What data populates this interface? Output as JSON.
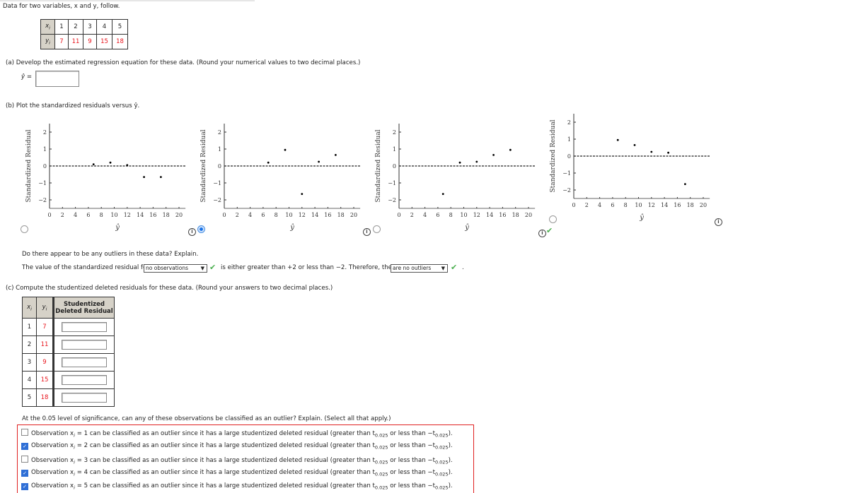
{
  "intro": "Data for two variables, x and y, follow.",
  "data_table": {
    "x_label": "x",
    "x_sub": "i",
    "y_label": "y",
    "y_sub": "i",
    "x": [
      1,
      2,
      3,
      4,
      5
    ],
    "y": [
      7,
      11,
      9,
      15,
      18
    ]
  },
  "part_a": {
    "text": "(a)  Develop the estimated regression equation for these data. (Round your numerical values to two decimal places.)",
    "yhat_label": "ŷ =",
    "yhat_value": ""
  },
  "part_b": {
    "text": "(b)  Plot the standardized residuals versus ŷ."
  },
  "chart_data": [
    {
      "type": "scatter",
      "x": [
        6.8,
        9.4,
        12.0,
        14.6,
        17.2
      ],
      "y": [
        0.1,
        0.2,
        0.05,
        -0.65,
        -0.65
      ],
      "xlabel": "ŷ",
      "ylabel": "Standardized Residual",
      "xlim": [
        0,
        21
      ],
      "ylim": [
        -2.5,
        2.5
      ],
      "xticks": [
        0,
        2,
        4,
        6,
        8,
        10,
        12,
        14,
        16,
        18,
        20
      ],
      "yticks": [
        -2,
        -1,
        0,
        1,
        2
      ],
      "reference_line": 0,
      "selected": false
    },
    {
      "type": "scatter",
      "x": [
        6.8,
        9.4,
        12.0,
        14.6,
        17.2
      ],
      "y": [
        0.2,
        0.95,
        -1.65,
        0.25,
        0.65
      ],
      "xlabel": "ŷ",
      "ylabel": "Standardized Residual",
      "xlim": [
        0,
        21
      ],
      "ylim": [
        -2.5,
        2.5
      ],
      "xticks": [
        0,
        2,
        4,
        6,
        8,
        10,
        12,
        14,
        16,
        18,
        20
      ],
      "yticks": [
        -2,
        -1,
        0,
        1,
        2
      ],
      "reference_line": 0,
      "selected": true
    },
    {
      "type": "scatter",
      "x": [
        6.8,
        9.4,
        12.0,
        14.6,
        17.2
      ],
      "y": [
        -1.65,
        0.2,
        0.25,
        0.65,
        0.95
      ],
      "xlabel": "ŷ",
      "ylabel": "Standardized Residual",
      "xlim": [
        0,
        21
      ],
      "ylim": [
        -2.5,
        2.5
      ],
      "xticks": [
        0,
        2,
        4,
        6,
        8,
        10,
        12,
        14,
        16,
        18,
        20
      ],
      "yticks": [
        -2,
        -1,
        0,
        1,
        2
      ],
      "reference_line": 0,
      "selected": false,
      "marked_correct": true
    },
    {
      "type": "scatter",
      "x": [
        6.8,
        9.4,
        12.0,
        14.6,
        17.2
      ],
      "y": [
        0.95,
        0.65,
        0.25,
        0.2,
        -1.65
      ],
      "xlabel": "ŷ",
      "ylabel": "Standardized Residual",
      "xlim": [
        0,
        21
      ],
      "ylim": [
        -2.5,
        2.5
      ],
      "xticks": [
        0,
        2,
        4,
        6,
        8,
        10,
        12,
        14,
        16,
        18,
        20
      ],
      "yticks": [
        -2,
        -1,
        0,
        1,
        2
      ],
      "reference_line": 0,
      "selected": false
    }
  ],
  "outliers": {
    "question": "Do there appear to be any outliers in these data? Explain.",
    "pre": "The value of the standardized residual for",
    "select1": "no observations",
    "mid": "is either greater than +2 or less than −2. Therefore, there",
    "select2": "are no outliers",
    "end": "."
  },
  "part_c": {
    "text": "(c)  Compute the studentized deleted residuals for these data. (Round your answers to two decimal places.)",
    "col3_line1": "Studentized",
    "col3_line2": "Deleted Residual",
    "rows": [
      {
        "x": "1",
        "y": "7",
        "value": ""
      },
      {
        "x": "2",
        "y": "11",
        "value": ""
      },
      {
        "x": "3",
        "y": "9",
        "value": ""
      },
      {
        "x": "4",
        "y": "15",
        "value": ""
      },
      {
        "x": "5",
        "y": "18",
        "value": ""
      }
    ]
  },
  "significance": {
    "question": "At the 0.05 level of significance, can any of these observations be classified as an outlier? Explain. (Select all that apply.)",
    "options": [
      {
        "pre": "Observation x",
        "sub": "i",
        "post": " = 1 can be classified as an outlier since it has a large studentized deleted residual (greater than t",
        "t": "0.025",
        "mid": " or less than −t",
        "t2": "0.025",
        "end": ").",
        "checked": false
      },
      {
        "pre": "Observation x",
        "sub": "i",
        "post": " = 2 can be classified as an outlier since it has a large studentized deleted residual (greater than t",
        "t": "0.025",
        "mid": " or less than −t",
        "t2": "0.025",
        "end": ").",
        "checked": true
      },
      {
        "pre": "Observation x",
        "sub": "i",
        "post": " = 3 can be classified as an outlier since it has a large studentized deleted residual (greater than t",
        "t": "0.025",
        "mid": " or less than −t",
        "t2": "0.025",
        "end": ").",
        "checked": false
      },
      {
        "pre": "Observation x",
        "sub": "i",
        "post": " = 4 can be classified as an outlier since it has a large studentized deleted residual (greater than t",
        "t": "0.025",
        "mid": " or less than −t",
        "t2": "0.025",
        "end": ").",
        "checked": true
      },
      {
        "pre": "Observation x",
        "sub": "i",
        "post": " = 5 can be classified as an outlier since it has a large studentized deleted residual (greater than t",
        "t": "0.025",
        "mid": " or less than −t",
        "t2": "0.025",
        "end": ").",
        "checked": true
      }
    ]
  },
  "colors": {
    "data_red": "#e8141c",
    "error_border": "#e02020",
    "check_green": "#4caf50",
    "radio_selected": "#1a73e8"
  }
}
